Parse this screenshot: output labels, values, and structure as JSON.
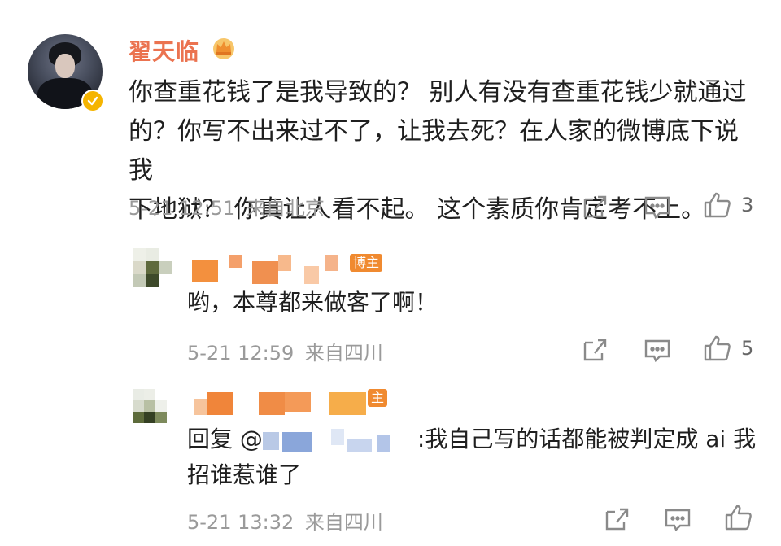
{
  "main_comment": {
    "username": "翟天临",
    "lines": [
      "你查重花钱了是我导致的？ 别人有没有查重花钱少就通过",
      "的？你写不出来过不了，让我去死？在人家的微博底下说我",
      "下地狱？  你真让人看不起。  这个素质你肯定考不上。"
    ],
    "timestamp": "5-21 12:51",
    "location": "来自北京",
    "like_count": "3"
  },
  "replies": [
    {
      "author_badge": "博主",
      "text": "哟，本尊都来做客了啊！",
      "timestamp": "5-21 12:59",
      "location": "来自四川",
      "like_count": "5"
    },
    {
      "author_badge": "主",
      "reply_prefix": "回复 @",
      "reply_text_line1": ":我自己写的话都能被判定成 ai 我",
      "reply_text_line2": "招谁惹谁了",
      "timestamp": "5-21 13:32",
      "location": "来自四川",
      "like_count": ""
    }
  ],
  "icons": {
    "share": "share-icon",
    "comment": "comment-icon",
    "like": "thumbs-up-icon",
    "verified": "verified-icon",
    "crown": "crown-icon"
  },
  "colors": {
    "username": "#eb7350",
    "meta": "#9a9a9a",
    "accent_orange": "#f08a30",
    "verified": "#f5b400"
  }
}
